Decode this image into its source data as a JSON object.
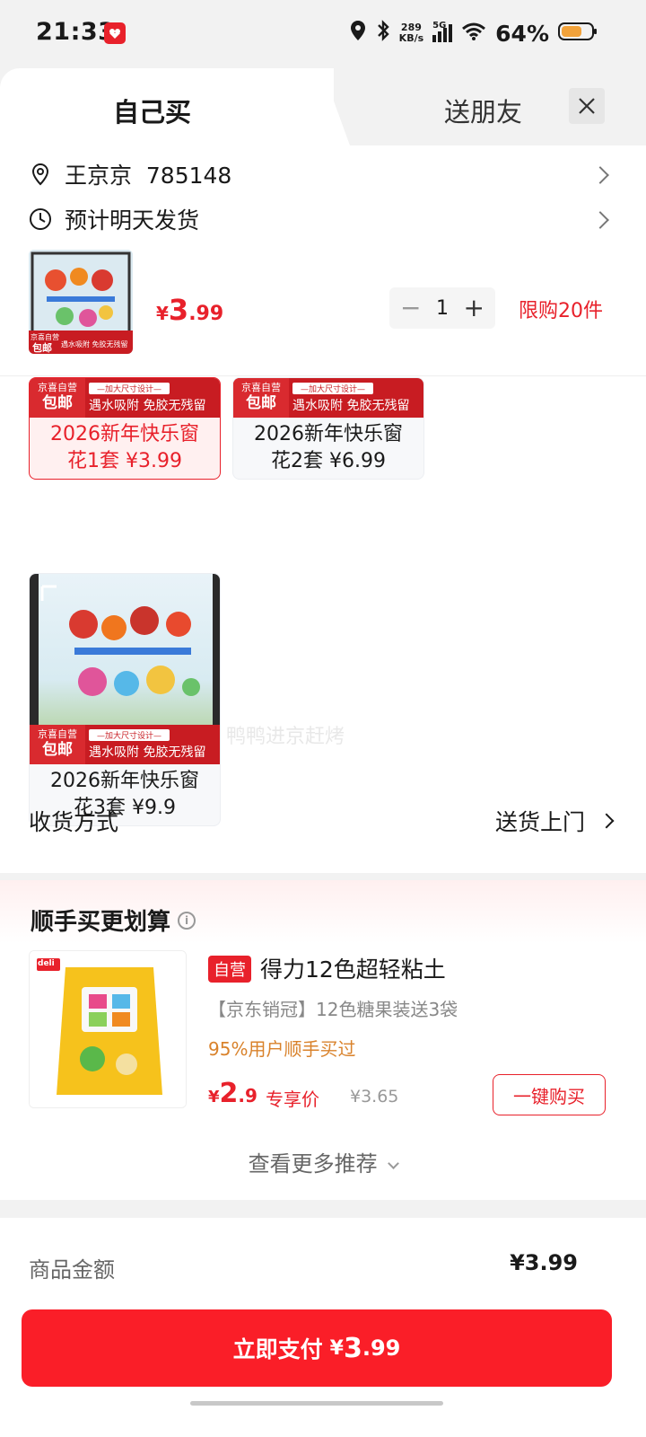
{
  "status": {
    "time": "21:33",
    "net_speed_top": "289",
    "net_speed_bottom": "KB/s",
    "network": "5G",
    "battery": "64%"
  },
  "tabs": {
    "buy_self": "自己买",
    "gift": "送朋友"
  },
  "address": {
    "name_phone": "王京京  785148",
    "ship_note": "预计明天发货"
  },
  "product": {
    "price_yen": "¥",
    "price_int": "3",
    "price_dec": ".99",
    "quantity": "1",
    "limit": "限购20件",
    "thumb_tag_top": "京喜自营",
    "thumb_tag": "包邮",
    "thumb_slogan": "遇水吸附 免胶无残留"
  },
  "variants": [
    {
      "line1": "2026新年快乐窗",
      "line2": "花1套  ¥3.99",
      "tag_top": "京喜自营",
      "tag": "包邮",
      "slogan_top": "—加大尺寸设计—",
      "slogan": "遇水吸附 免胶无残留"
    },
    {
      "line1": "2026新年快乐窗",
      "line2": "花2套  ¥6.99",
      "tag_top": "京喜自营",
      "tag": "包邮",
      "slogan_top": "—加大尺寸设计—",
      "slogan": "遇水吸附 免胶无残留"
    },
    {
      "line1": "2026新年快乐窗",
      "line2": "花3套  ¥9.9",
      "tag_top": "京喜自营",
      "tag": "包邮",
      "slogan_top": "—加大尺寸设计—",
      "slogan": "遇水吸附 免胶无残留"
    }
  ],
  "watermark": "鸭鸭进京赶烤",
  "receive": {
    "label": "收货方式",
    "value": "送货上门"
  },
  "recommend": {
    "title": "顺手买更划算",
    "badge": "自营",
    "name": "得力12色超轻粘土",
    "desc": "【京东销冠】12色糖果装送3袋",
    "percent": "95%用户顺手买过",
    "price_yen": "¥",
    "price_int": "2",
    "price_dec": ".9",
    "exclusive": "专享价",
    "original": "¥3.65",
    "buy_label": "一键购买",
    "more": "查看更多推荐",
    "brand": "deli"
  },
  "amount": {
    "label": "商品金额",
    "value": "¥3.99"
  },
  "pay": {
    "label": "立即支付",
    "yen": "¥",
    "int": "3",
    "dec": ".99"
  },
  "colors": {
    "accent": "#e8212b",
    "pay_button": "#fa1e28"
  }
}
